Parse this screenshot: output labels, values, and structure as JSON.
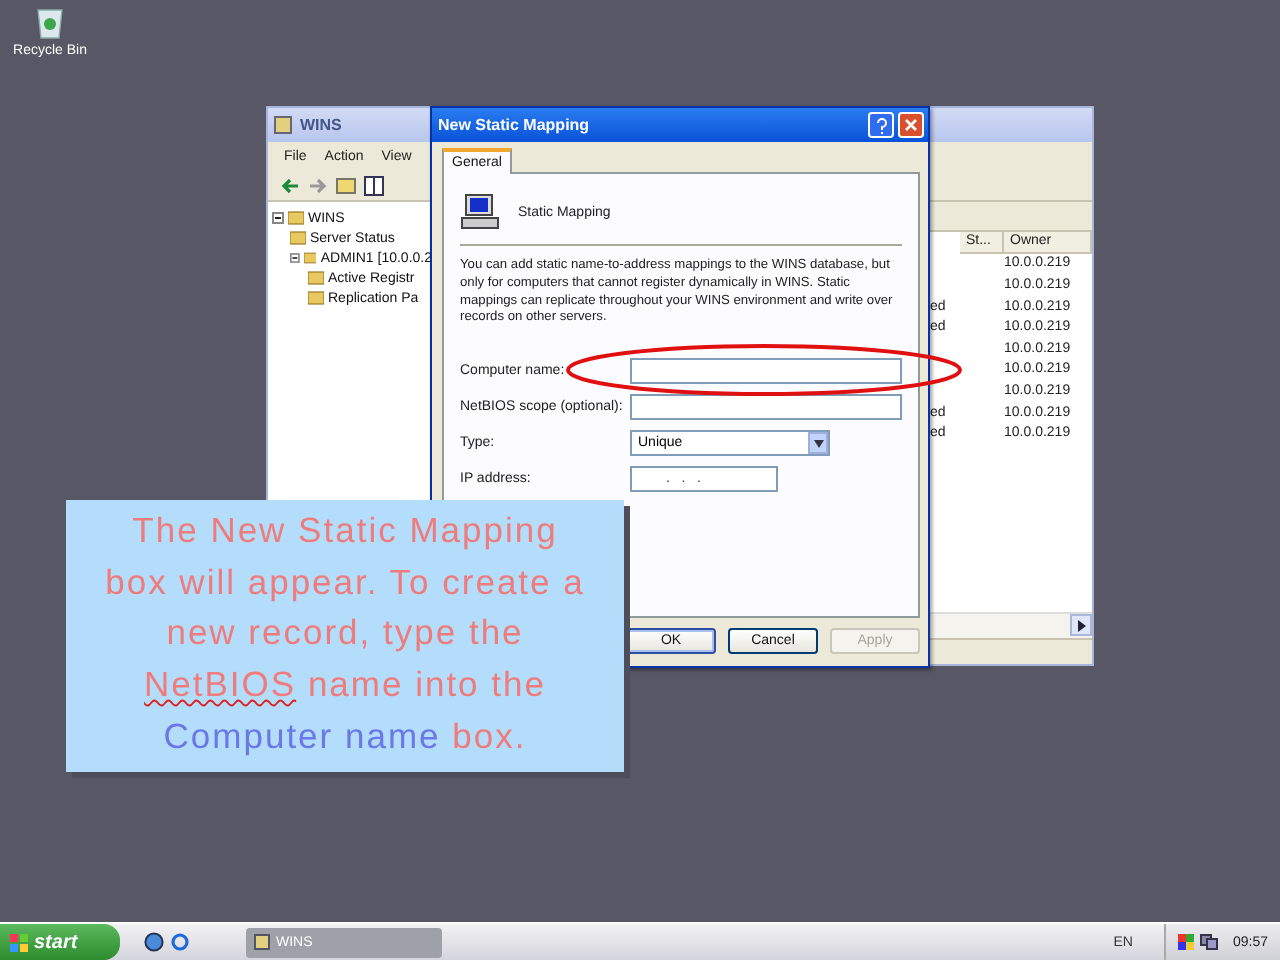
{
  "desktop": {
    "icons": [
      {
        "label": "Recycle Bin"
      }
    ]
  },
  "wins_window": {
    "title": "WINS",
    "menu": [
      "File",
      "Action",
      "View"
    ],
    "tree": [
      {
        "label": "WINS",
        "expanded": true,
        "children": [
          {
            "label": "Server Status"
          },
          {
            "label": "ADMIN1 [10.0.0.2",
            "expanded": true,
            "children": [
              {
                "label": "Active Registr"
              },
              {
                "label": "Replication Pa"
              }
            ]
          }
        ]
      }
    ],
    "columns": [
      "St...",
      "Owner"
    ],
    "rows": [
      {
        "owner": "10.0.0.219"
      },
      {
        "owner": "10.0.0.219"
      },
      {
        "column_1": "ed",
        "owner": "10.0.0.219"
      },
      {
        "column_1": "ed",
        "owner": "10.0.0.219"
      },
      {
        "owner": "10.0.0.219"
      },
      {
        "owner": "10.0.0.219"
      },
      {
        "owner": "10.0.0.219"
      },
      {
        "column_1": "ed",
        "owner": "10.0.0.219"
      },
      {
        "column_1": "ed",
        "owner": "10.0.0.219"
      }
    ]
  },
  "dialog": {
    "title": "New Static Mapping",
    "tabs": [
      {
        "label": "General",
        "selected": true
      }
    ],
    "heading": "Static Mapping",
    "description": "You can add static name-to-address mappings to the WINS database, but only for computers that cannot register dynamically in WINS. Static mappings can replicate throughout your WINS environment and write over records on other servers.",
    "fields": [
      {
        "kind": "text",
        "label": "Computer name:",
        "highlighted": true
      },
      {
        "kind": "text",
        "label": "NetBIOS scope (optional):",
        "highlighted": false
      },
      {
        "kind": "select",
        "label": "Type:",
        "value": "Unique",
        "highlighted": false
      },
      {
        "kind": "ip",
        "label": "IP address:",
        "value": ".   .   .",
        "highlighted": false
      }
    ],
    "buttons": [
      {
        "label": "OK",
        "disabled": false,
        "default": true
      },
      {
        "label": "Cancel",
        "disabled": false,
        "default": false
      },
      {
        "label": "Apply",
        "disabled": true,
        "default": false
      }
    ]
  },
  "callout": {
    "segments": [
      {
        "text": "The New Static Mapping box will appear. To create a new record, type the ",
        "kind": "normal"
      },
      {
        "text": "NetBIOS",
        "kind": "misspelled"
      },
      {
        "text": " name into the ",
        "kind": "normal"
      },
      {
        "text": "Computer name",
        "kind": "highlight"
      },
      {
        "text": " box.",
        "kind": "normal"
      }
    ]
  },
  "taskbar": {
    "start": "start",
    "tasks": [
      {
        "label": "WINS",
        "selected": false
      }
    ],
    "language": "EN",
    "clock": "09:57"
  }
}
